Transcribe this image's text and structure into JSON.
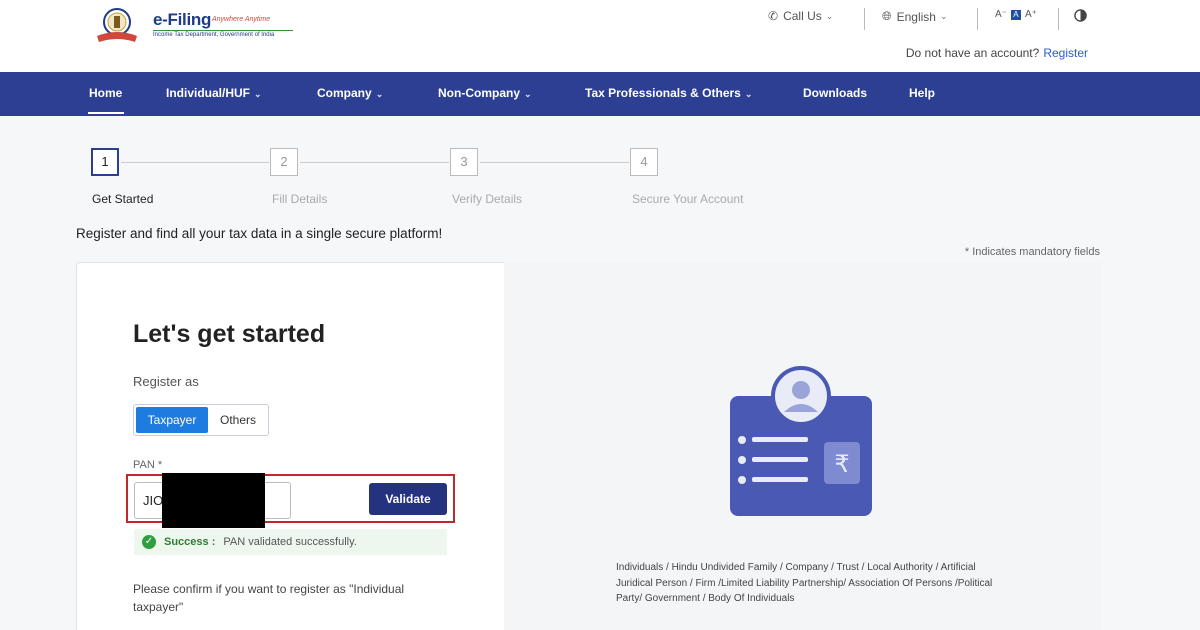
{
  "brand": {
    "title": "e-Filing",
    "tagline": "Anywhere Anytime",
    "subtitle": "Income Tax Department, Government of India"
  },
  "utility": {
    "call_us": "Call Us",
    "language": "English",
    "font_decrease": "A⁻",
    "font_normal": "A",
    "font_increase": "A⁺",
    "no_account_text": "Do not have an account?",
    "register_link": "Register"
  },
  "nav": {
    "items": [
      {
        "label": "Home"
      },
      {
        "label": "Individual/HUF"
      },
      {
        "label": "Company"
      },
      {
        "label": "Non-Company"
      },
      {
        "label": "Tax Professionals & Others"
      },
      {
        "label": "Downloads"
      },
      {
        "label": "Help"
      }
    ]
  },
  "stepper": {
    "steps": [
      {
        "number": "1",
        "label": "Get Started"
      },
      {
        "number": "2",
        "label": "Fill Details"
      },
      {
        "number": "3",
        "label": "Verify Details"
      },
      {
        "number": "4",
        "label": "Secure Your Account"
      }
    ],
    "current": 1
  },
  "intro": "Register and find all your tax data in a single secure platform!",
  "mandatory_note": "* Indicates mandatory fields",
  "form": {
    "title": "Let's get started",
    "register_as_label": "Register as",
    "toggle": {
      "taxpayer": "Taxpayer",
      "others": "Others",
      "selected": "Taxpayer"
    },
    "pan_label": "PAN *",
    "pan_value": "JIO",
    "validate_button": "Validate",
    "success_label": "Success :",
    "success_message": "PAN validated successfully.",
    "confirm_text": "Please confirm if you want to register as \"Individual taxpayer\""
  },
  "entities_text": "Individuals / Hindu Undivided Family / Company / Trust / Local Authority / Artificial Juridical Person / Firm /Limited Liability Partnership/ Association Of Persons /Political Party/ Government / Body Of Individuals",
  "colors": {
    "nav_bg": "#2c3f92",
    "primary_button": "#24327f",
    "toggle_active": "#1e7be0",
    "highlight_border": "#c0282d",
    "success": "#2e7d32",
    "link": "#2a5bd7"
  }
}
